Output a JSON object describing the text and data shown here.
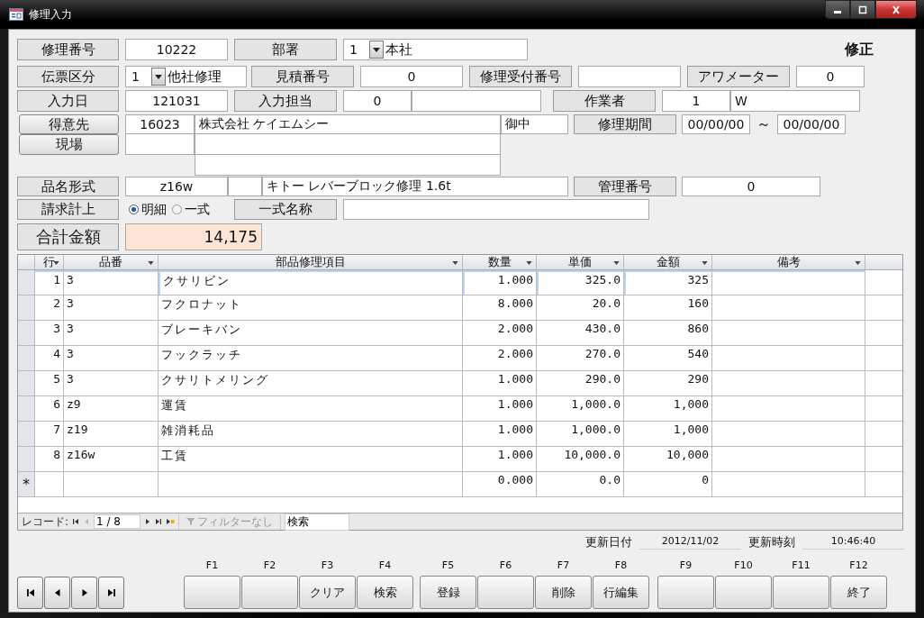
{
  "window": {
    "title": "修理入力"
  },
  "mode": "修正",
  "repair_no": {
    "label": "修理番号",
    "value": "10222"
  },
  "department": {
    "label": "部署",
    "code": "1",
    "name": "本社"
  },
  "slip_type": {
    "label": "伝票区分",
    "code": "1",
    "name": "他社修理"
  },
  "estimate_no": {
    "label": "見積番号",
    "value": "0"
  },
  "reception_no": {
    "label": "修理受付番号"
  },
  "hour_meter": {
    "label": "アワメーター",
    "value": "0"
  },
  "input_date": {
    "label": "入力日",
    "value": "121031"
  },
  "input_staff": {
    "label": "入力担当",
    "code": "0"
  },
  "worker": {
    "label": "作業者",
    "code": "1",
    "name": "W"
  },
  "customer": {
    "label": "得意先",
    "code": "16023",
    "name": "株式会社  ケイエムシー",
    "suffix": "御中"
  },
  "repair_period": {
    "label": "修理期間",
    "from": "00/00/00",
    "separator": "～",
    "to": "00/00/00"
  },
  "site": {
    "label": "現場"
  },
  "product": {
    "label": "品名形式",
    "code": "z16w",
    "name": "キトー レバーブロック修理  1.6t"
  },
  "control_no": {
    "label": "管理番号",
    "value": "0"
  },
  "billing": {
    "label": "請求計上",
    "options": [
      {
        "label": "明細",
        "selected": true
      },
      {
        "label": "一式",
        "selected": false
      }
    ]
  },
  "set_name": {
    "label": "一式名称"
  },
  "total": {
    "label": "合計金額",
    "value": "14,175"
  },
  "grid": {
    "columns": [
      "行",
      "品番",
      "部品修理項目",
      "数量",
      "単価",
      "金額",
      "備考"
    ],
    "rows": [
      {
        "line": "1",
        "part_no": "3",
        "item": "クサリビン",
        "qty": "1.000",
        "price": "325.0",
        "amount": "325",
        "selected": true
      },
      {
        "line": "2",
        "part_no": "3",
        "item": "フクロナット",
        "qty": "8.000",
        "price": "20.0",
        "amount": "160",
        "selected": false
      },
      {
        "line": "3",
        "part_no": "3",
        "item": "ブレーキバン",
        "qty": "2.000",
        "price": "430.0",
        "amount": "860",
        "selected": false
      },
      {
        "line": "4",
        "part_no": "3",
        "item": "フックラッチ",
        "qty": "2.000",
        "price": "270.0",
        "amount": "540",
        "selected": false
      },
      {
        "line": "5",
        "part_no": "3",
        "item": "クサリトメリング",
        "qty": "1.000",
        "price": "290.0",
        "amount": "290",
        "selected": false
      },
      {
        "line": "6",
        "part_no": "z9",
        "item": "運賃",
        "qty": "1.000",
        "price": "1,000.0",
        "amount": "1,000",
        "selected": false
      },
      {
        "line": "7",
        "part_no": "z19",
        "item": "雑消耗品",
        "qty": "1.000",
        "price": "1,000.0",
        "amount": "1,000",
        "selected": false
      },
      {
        "line": "8",
        "part_no": "z16w",
        "item": "工賃",
        "qty": "1.000",
        "price": "10,000.0",
        "amount": "10,000",
        "selected": false
      }
    ],
    "new_row": {
      "marker": "*",
      "qty": "0.000",
      "price": "0.0",
      "amount": "0"
    },
    "navigator": {
      "label": "レコード:",
      "position": "1 / 8",
      "filter": "フィルターなし",
      "search": "検索"
    }
  },
  "updated": {
    "date_label": "更新日付",
    "date": "2012/11/02",
    "time_label": "更新時刻",
    "time": "10:46:40"
  },
  "function_keys": [
    {
      "key": "F1"
    },
    {
      "key": "F2"
    },
    {
      "key": "F3",
      "label": "クリア"
    },
    {
      "key": "F4",
      "label": "検索"
    },
    {
      "key": "F5",
      "label": "登録"
    },
    {
      "key": "F6"
    },
    {
      "key": "F7",
      "label": "削除"
    },
    {
      "key": "F8",
      "label": "行編集"
    },
    {
      "key": "F9"
    },
    {
      "key": "F10"
    },
    {
      "key": "F11"
    },
    {
      "key": "F12",
      "label": "終了"
    }
  ]
}
